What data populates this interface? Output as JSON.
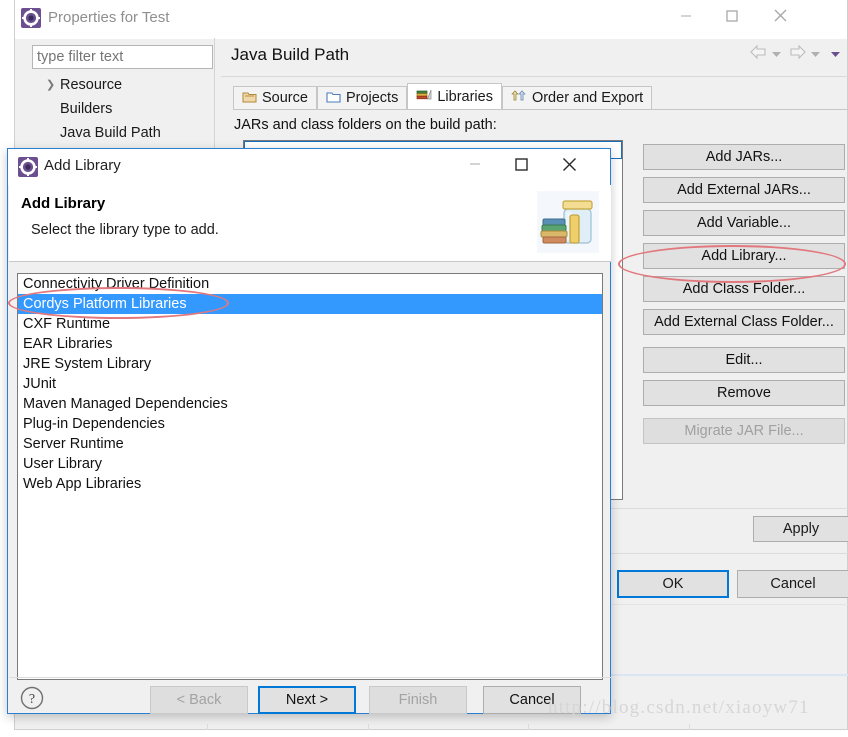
{
  "properties_window": {
    "title": "Properties for Test",
    "app_icon": "gear-icon",
    "window_controls": {
      "minimize": "—",
      "maximize": "□",
      "close": "✕"
    },
    "filter": {
      "placeholder": "type filter text",
      "value": ""
    },
    "tree": [
      {
        "label": "Resource",
        "expandable": true,
        "selected": false
      },
      {
        "label": "Builders",
        "expandable": false,
        "selected": false
      },
      {
        "label": "Java Build Path",
        "expandable": false,
        "selected": true
      }
    ],
    "page_title": "Java Build Path",
    "nav": {
      "back": "⇦",
      "back_menu": "▼",
      "forward": "⇨",
      "forward_menu": "▼",
      "view_menu": "▼"
    },
    "tabs": [
      {
        "label": "Source",
        "icon": "source-folder-icon",
        "active": false
      },
      {
        "label": "Projects",
        "icon": "projects-folder-icon",
        "active": false
      },
      {
        "label": "Libraries",
        "icon": "libraries-books-icon",
        "active": true
      },
      {
        "label": "Order and Export",
        "icon": "order-export-icon",
        "active": false
      }
    ],
    "jars_label": "JARs and class folders on the build path:",
    "side_buttons": [
      {
        "label": "Add JARs...",
        "disabled": false,
        "gap": false
      },
      {
        "label": "Add External JARs...",
        "disabled": false,
        "gap": false
      },
      {
        "label": "Add Variable...",
        "disabled": false,
        "gap": false
      },
      {
        "label": "Add Library...",
        "disabled": false,
        "gap": false
      },
      {
        "label": "Add Class Folder...",
        "disabled": false,
        "gap": false
      },
      {
        "label": "Add External Class Folder...",
        "disabled": false,
        "gap": false
      },
      {
        "label": "Edit...",
        "disabled": false,
        "gap": true
      },
      {
        "label": "Remove",
        "disabled": false,
        "gap": false
      },
      {
        "label": "Migrate JAR File...",
        "disabled": true,
        "gap": true
      }
    ],
    "apply_label": "Apply",
    "ok_label": "OK",
    "cancel_label": "Cancel"
  },
  "add_library_dialog": {
    "title": "Add Library",
    "app_icon": "gear-icon",
    "window_controls": {
      "minimize": "—",
      "maximize": "□",
      "close": "✕"
    },
    "header_title": "Add Library",
    "header_subtitle": "Select the library type to add.",
    "header_icon": "jar-with-books-icon",
    "library_types": [
      {
        "label": "Connectivity Driver Definition",
        "selected": false
      },
      {
        "label": "Cordys Platform Libraries",
        "selected": true
      },
      {
        "label": "CXF Runtime",
        "selected": false
      },
      {
        "label": "EAR Libraries",
        "selected": false
      },
      {
        "label": "JRE System Library",
        "selected": false
      },
      {
        "label": "JUnit",
        "selected": false
      },
      {
        "label": "Maven Managed Dependencies",
        "selected": false
      },
      {
        "label": "Plug-in Dependencies",
        "selected": false
      },
      {
        "label": "Server Runtime",
        "selected": false
      },
      {
        "label": "User Library",
        "selected": false
      },
      {
        "label": "Web App Libraries",
        "selected": false
      }
    ],
    "help_icon": "question-mark-icon",
    "buttons": {
      "back": {
        "label": "< Back",
        "disabled": true,
        "default": false
      },
      "next": {
        "label": "Next >",
        "disabled": false,
        "default": true
      },
      "finish": {
        "label": "Finish",
        "disabled": true,
        "default": false
      },
      "cancel": {
        "label": "Cancel",
        "disabled": false,
        "default": false
      }
    }
  },
  "annotations": {
    "ellipse_color": "#e2787d",
    "highlighted_button": "Add Library...",
    "highlighted_list_item": "Cordys Platform Libraries"
  },
  "watermark": {
    "text": "http://blog.csdn.net/xiaoyw71"
  },
  "colors": {
    "selection_blue": "#3399ff",
    "default_button_border": "#0078d7",
    "dialog_border": "#2a7fd4",
    "window_bg": "#f0f0f0",
    "annotation_red": "#e2787d"
  }
}
